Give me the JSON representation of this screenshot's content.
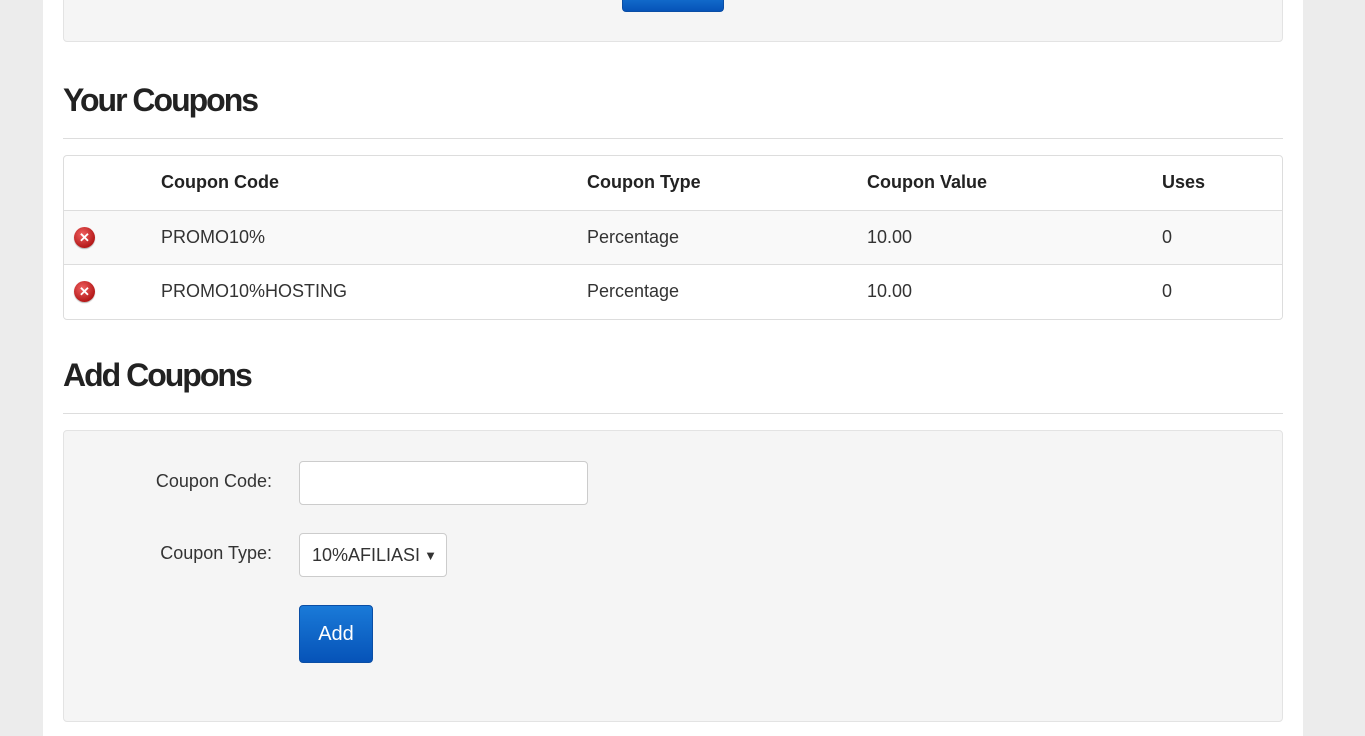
{
  "sections": {
    "your_coupons_title": "Your Coupons",
    "add_coupons_title": "Add Coupons"
  },
  "coupons_table": {
    "headers": {
      "code": "Coupon Code",
      "type": "Coupon Type",
      "value": "Coupon Value",
      "uses": "Uses"
    },
    "rows": [
      {
        "code": "PROMO10%",
        "type": "Percentage",
        "value": "10.00",
        "uses": "0"
      },
      {
        "code": "PROMO10%HOSTING",
        "type": "Percentage",
        "value": "10.00",
        "uses": "0"
      }
    ],
    "delete_icon": "delete-circle-icon"
  },
  "add_form": {
    "code_label": "Coupon Code:",
    "code_value": "",
    "type_label": "Coupon Type:",
    "type_selected": "10%AFILIASI",
    "add_label": "Add"
  },
  "colors": {
    "primary_button": "#0a62c8",
    "delete_icon": "#c62828"
  }
}
